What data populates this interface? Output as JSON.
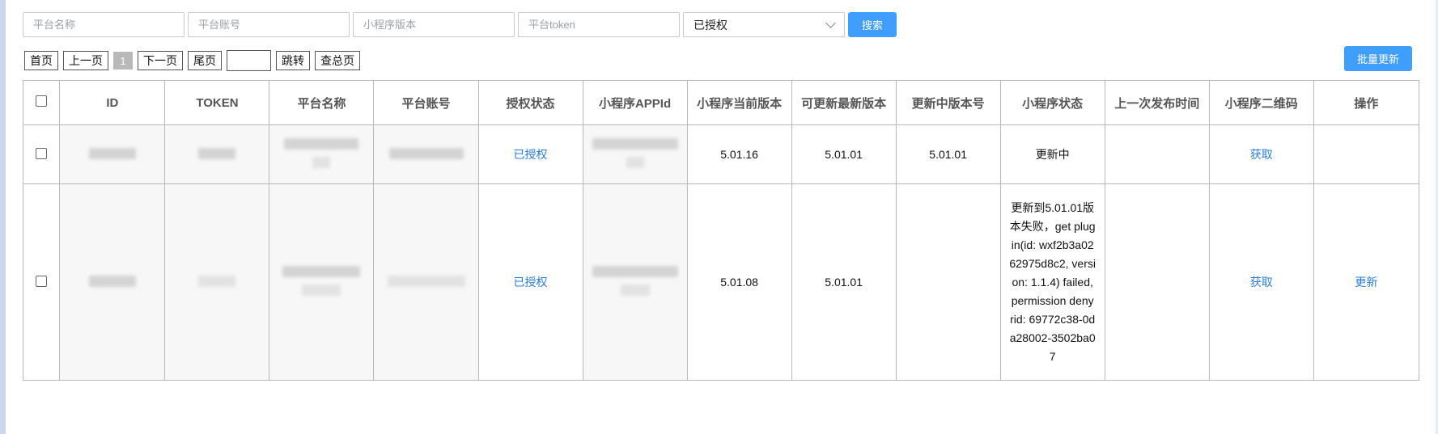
{
  "filters": {
    "platform_name_placeholder": "平台名称",
    "platform_account_placeholder": "平台账号",
    "mini_version_placeholder": "小程序版本",
    "platform_token_placeholder": "平台token",
    "auth_select_value": "已授权",
    "search_label": "搜索"
  },
  "pager": {
    "first": "首页",
    "prev": "上一页",
    "current": "1",
    "next": "下一页",
    "last": "尾页",
    "jump": "跳转",
    "total": "查总页"
  },
  "bulk_update_label": "批量更新",
  "table": {
    "headers": [
      "ID",
      "TOKEN",
      "平台名称",
      "平台账号",
      "授权状态",
      "小程序APPId",
      "小程序当前版本",
      "可更新最新版本",
      "更新中版本号",
      "小程序状态",
      "上一次发布时间",
      "小程序二维码",
      "操作"
    ],
    "rows": [
      {
        "auth_status": "已授权",
        "current_version": "5.01.16",
        "latest_version": "5.01.01",
        "updating_version": "5.01.01",
        "status": "更新中",
        "last_publish": "",
        "qrcode": "获取",
        "action": ""
      },
      {
        "auth_status": "已授权",
        "current_version": "5.01.08",
        "latest_version": "5.01.01",
        "updating_version": "",
        "status": "更新到5.01.01版本失败，get plugin(id: wxf2b3a0262975d8c2, version: 1.1.4) failed, permission deny rid: 69772c38-0da28002-3502ba07",
        "last_publish": "",
        "qrcode": "获取",
        "action": "更新"
      }
    ]
  },
  "colors": {
    "primary": "#409eff",
    "link": "#2a7ed8",
    "border": "#b8b8b8"
  }
}
